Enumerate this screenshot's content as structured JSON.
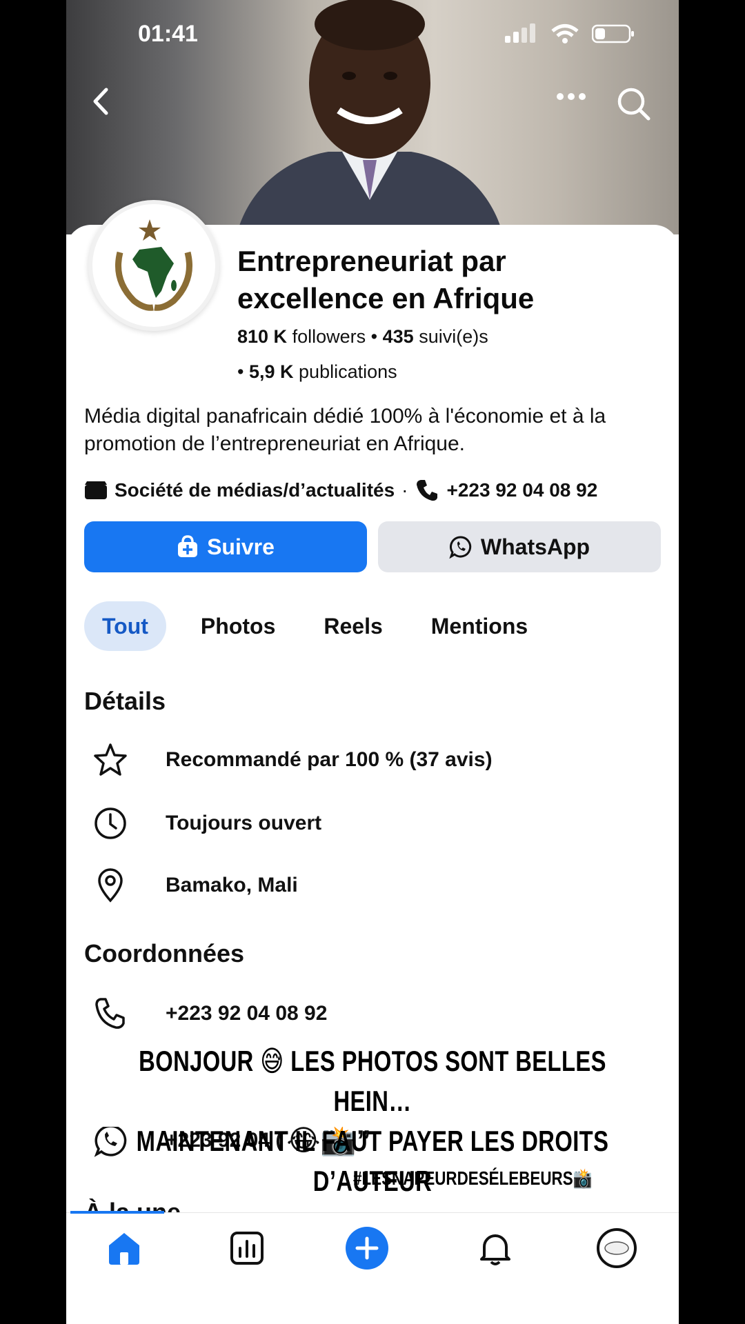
{
  "status": {
    "time": "01:41"
  },
  "profile": {
    "name": "Entrepreneuriat par excellence en Afrique",
    "followers_count": "810 K",
    "followers_label": "followers",
    "following_count": "435",
    "following_label": "suivi(e)s",
    "posts_count": "5,9 K",
    "posts_label": "publications",
    "bio": "Média digital panafricain dédié 100% à l'économie et à la promotion de l’entrepreneuriat en Afrique.",
    "category": "Société de médias/d’actualités",
    "phone": "+223 92 04 08 92"
  },
  "actions": {
    "follow_label": "Suivre",
    "whatsapp_label": "WhatsApp"
  },
  "tabs": [
    "Tout",
    "Photos",
    "Reels",
    "Mentions"
  ],
  "details": {
    "heading": "Détails",
    "items": [
      {
        "icon": "star-icon",
        "text": "Recommandé par 100 % (37 avis)"
      },
      {
        "icon": "clock-icon",
        "text": "Toujours ouvert"
      },
      {
        "icon": "location-pin-icon",
        "text": "Bamako, Mali"
      }
    ]
  },
  "contact": {
    "heading": "Coordonnées",
    "phone": "+223 92 04 08 92",
    "whatsapp_partial": "+223 92 04 ("
  },
  "featured_heading": "À la une",
  "overlay": {
    "line1": "BONJOUR 😅 LES PHOTOS SONT BELLES HEIN…",
    "line2": "MAINTENANT IL FAUT PAYER LES DROITS D’AUTEUR",
    "line3": "😂📸”",
    "hashtag": "#LESNAPEURDESÉLEBEURS📸"
  },
  "colors": {
    "accent": "#1877f2",
    "tab_active_bg": "#dbe7f8",
    "button_gray": "#e4e6eb"
  }
}
